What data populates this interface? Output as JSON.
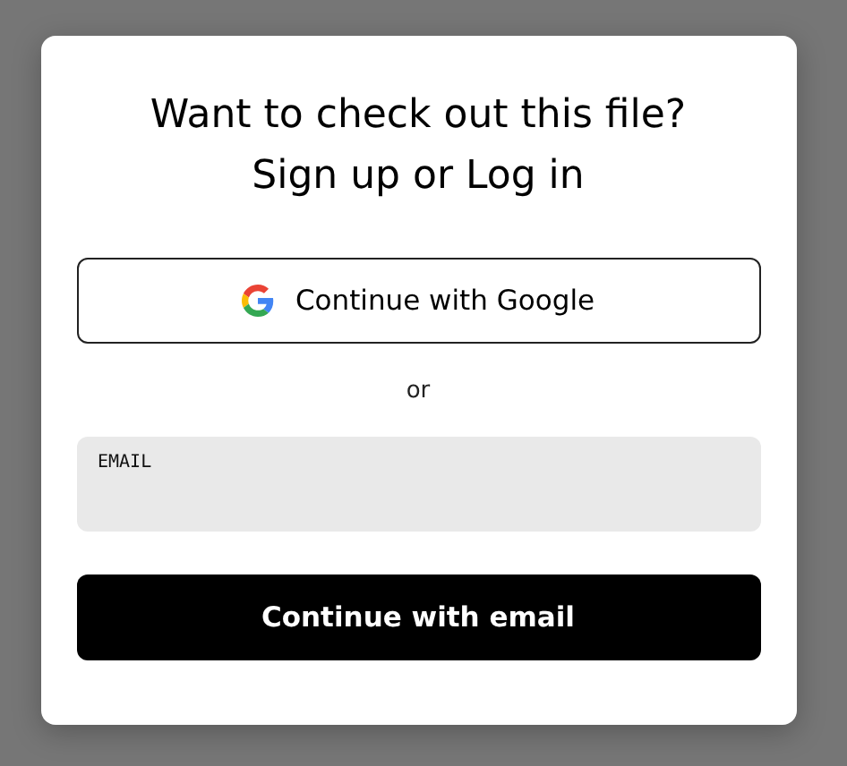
{
  "dialog": {
    "title_lines": [
      "Want to check out this file?",
      "Sign up or Log in"
    ],
    "google_button": {
      "label": "Continue with Google"
    },
    "divider_text": "or",
    "email_field": {
      "label": "EMAIL"
    },
    "email_button": {
      "label": "Continue with email"
    }
  }
}
